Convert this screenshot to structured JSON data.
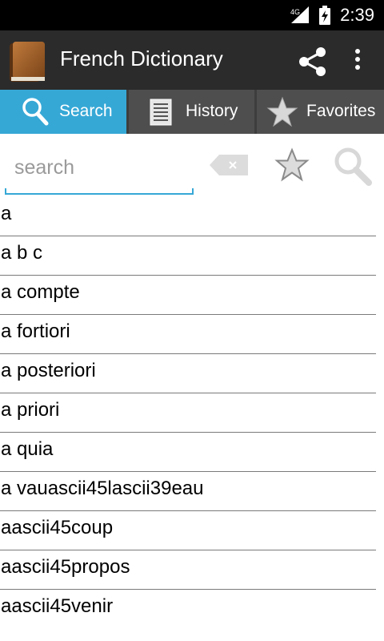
{
  "status_bar": {
    "time": "2:39",
    "network_label": "4G"
  },
  "action_bar": {
    "title": "French Dictionary",
    "icons": [
      "book-icon",
      "share-icon",
      "overflow-menu-icon"
    ]
  },
  "tabs": [
    {
      "label": "Search",
      "icon": "magnifier-icon",
      "active": true
    },
    {
      "label": "History",
      "icon": "list-icon",
      "active": false
    },
    {
      "label": "Favorites",
      "icon": "star-icon",
      "active": false
    }
  ],
  "search": {
    "placeholder": "search",
    "value": ""
  },
  "words": [
    "a",
    "a b c",
    "a compte",
    "a fortiori",
    "a posteriori",
    "a priori",
    "a quia",
    "a vauascii45lascii39eau",
    "aascii45coup",
    "aascii45propos",
    "aascii45venir"
  ],
  "colors": {
    "accent": "#36a8d6",
    "actionbar": "#2b2b2b",
    "tab_inactive": "#4e4e4e"
  }
}
